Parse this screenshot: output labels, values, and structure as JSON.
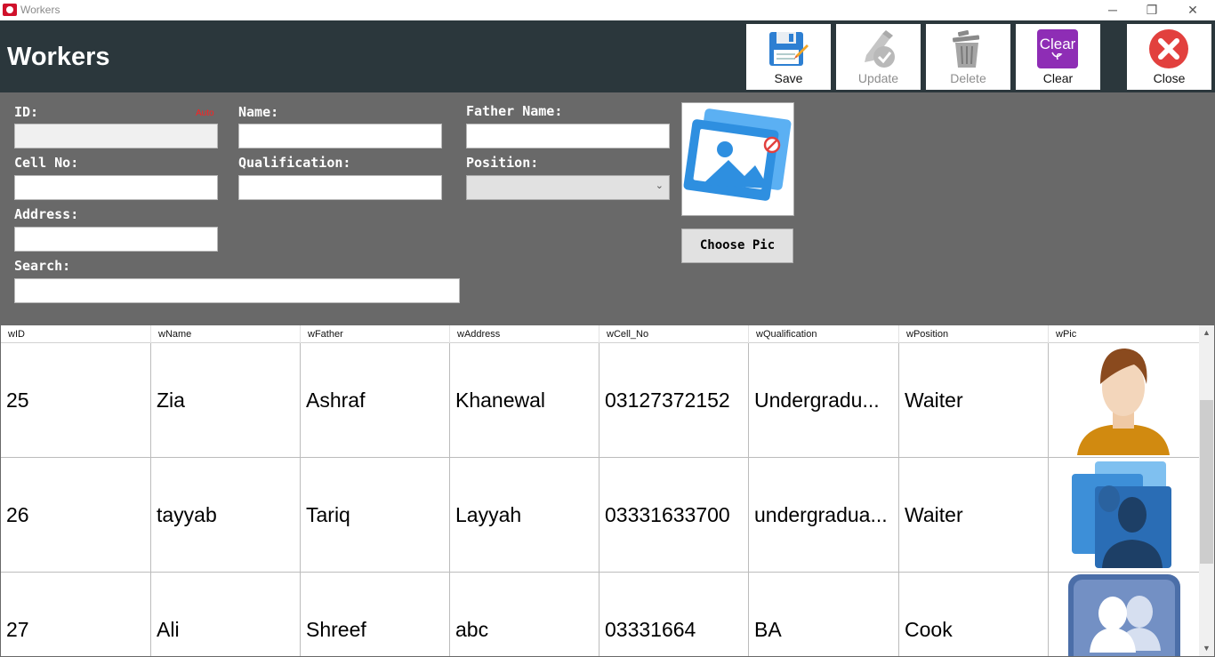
{
  "window": {
    "title": "Workers",
    "controls": {
      "minimize": "─",
      "restore": "❐",
      "close": "✕"
    }
  },
  "header": {
    "title": "Workers"
  },
  "toolbar": {
    "save_label": "Save",
    "update_label": "Update",
    "delete_label": "Delete",
    "clear_label": "Clear",
    "clear_icon_text": "Clear",
    "close_label": "Close"
  },
  "form": {
    "id_label": "ID:",
    "auto_label": "Auto",
    "name_label": "Name:",
    "father_label": "Father Name:",
    "cell_label": "Cell No:",
    "qualification_label": "Qualification:",
    "position_label": "Position:",
    "address_label": "Address:",
    "search_label": "Search:",
    "choose_pic_label": "Choose Pic",
    "position_arrow": "⌄"
  },
  "grid": {
    "columns": [
      "wID",
      "wName",
      "wFather",
      "wAddress",
      "wCell_No",
      "wQualification",
      "wPosition",
      "wPic"
    ],
    "rows": [
      {
        "wID": "25",
        "wName": "Zia",
        "wFather": "Ashraf",
        "wAddress": "Khanewal",
        "wCell_No": "03127372152",
        "wQualification": "Undergradu...",
        "wPosition": "Waiter",
        "pic_icon": "male-avatar-icon"
      },
      {
        "wID": "26",
        "wName": "tayyab",
        "wFather": "Tariq",
        "wAddress": "Layyah",
        "wCell_No": "03331633700",
        "wQualification": "undergradua...",
        "wPosition": "Waiter",
        "pic_icon": "user-group-glass-icon"
      },
      {
        "wID": "27",
        "wName": "Ali",
        "wFather": "Shreef",
        "wAddress": "abc",
        "wCell_No": "03331664",
        "wQualification": "BA",
        "wPosition": "Cook",
        "pic_icon": "users-icon"
      }
    ],
    "scroll_up": "▲",
    "scroll_down": "▼"
  },
  "colors": {
    "header_bg": "#2b373c",
    "form_bg": "#696969",
    "accent_blue": "#2e8fe0",
    "close_red": "#e2403e",
    "clear_purple": "#8e2db5"
  }
}
